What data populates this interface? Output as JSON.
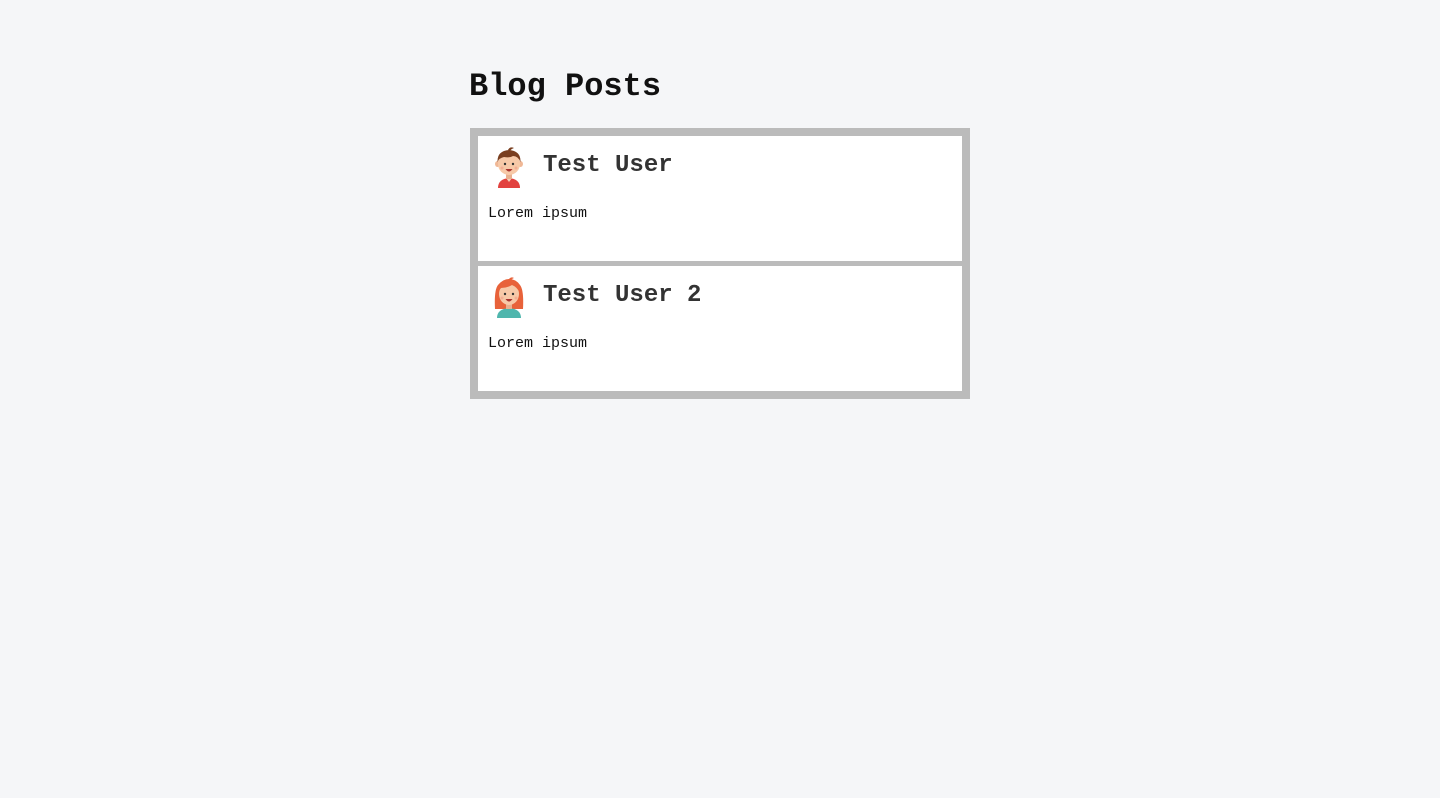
{
  "page": {
    "title": "Blog Posts"
  },
  "posts": [
    {
      "author": "Test User",
      "avatar_icon": "boy-avatar-icon",
      "body": "Lorem ipsum"
    },
    {
      "author": "Test User 2",
      "avatar_icon": "girl-avatar-icon",
      "body": "Lorem ipsum"
    }
  ],
  "colors": {
    "background": "#f5f6f8",
    "frame": "#bbbbbb",
    "card": "#ffffff"
  }
}
